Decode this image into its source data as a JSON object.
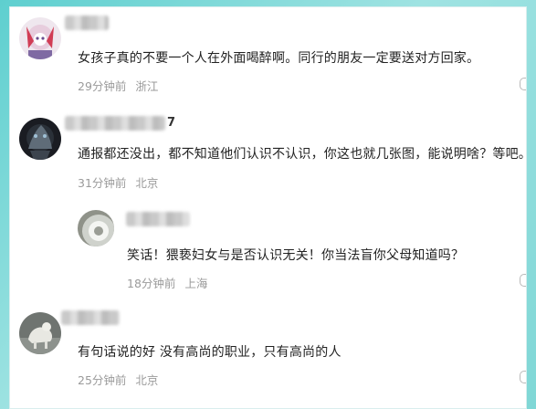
{
  "comments": [
    {
      "name_suffix": "",
      "text": "女孩子真的不要一个人在外面喝醉啊。同行的朋友一定要送对方回家。",
      "time": "29分钟前",
      "location": "浙江"
    },
    {
      "name_suffix": "7",
      "text": "通报都还没出，都不知道他们认识不认识，你这也就几张图，能说明啥？等吧。",
      "time": "31分钟前",
      "location": "北京"
    },
    {
      "name_suffix": "",
      "text": "笑话！猥亵妇女与是否认识无关！你当法盲你父母知道吗？",
      "time": "18分钟前",
      "location": "上海"
    },
    {
      "name_suffix": "",
      "text": "有句话说的好 没有高尚的职业，只有高尚的人",
      "time": "25分钟前",
      "location": "北京"
    }
  ],
  "colors": {
    "text": "#222222",
    "meta": "#9a9a9a",
    "background": "#ffffff",
    "frame": "#7fd7d6"
  },
  "icons": [
    "comment-more-icon"
  ]
}
